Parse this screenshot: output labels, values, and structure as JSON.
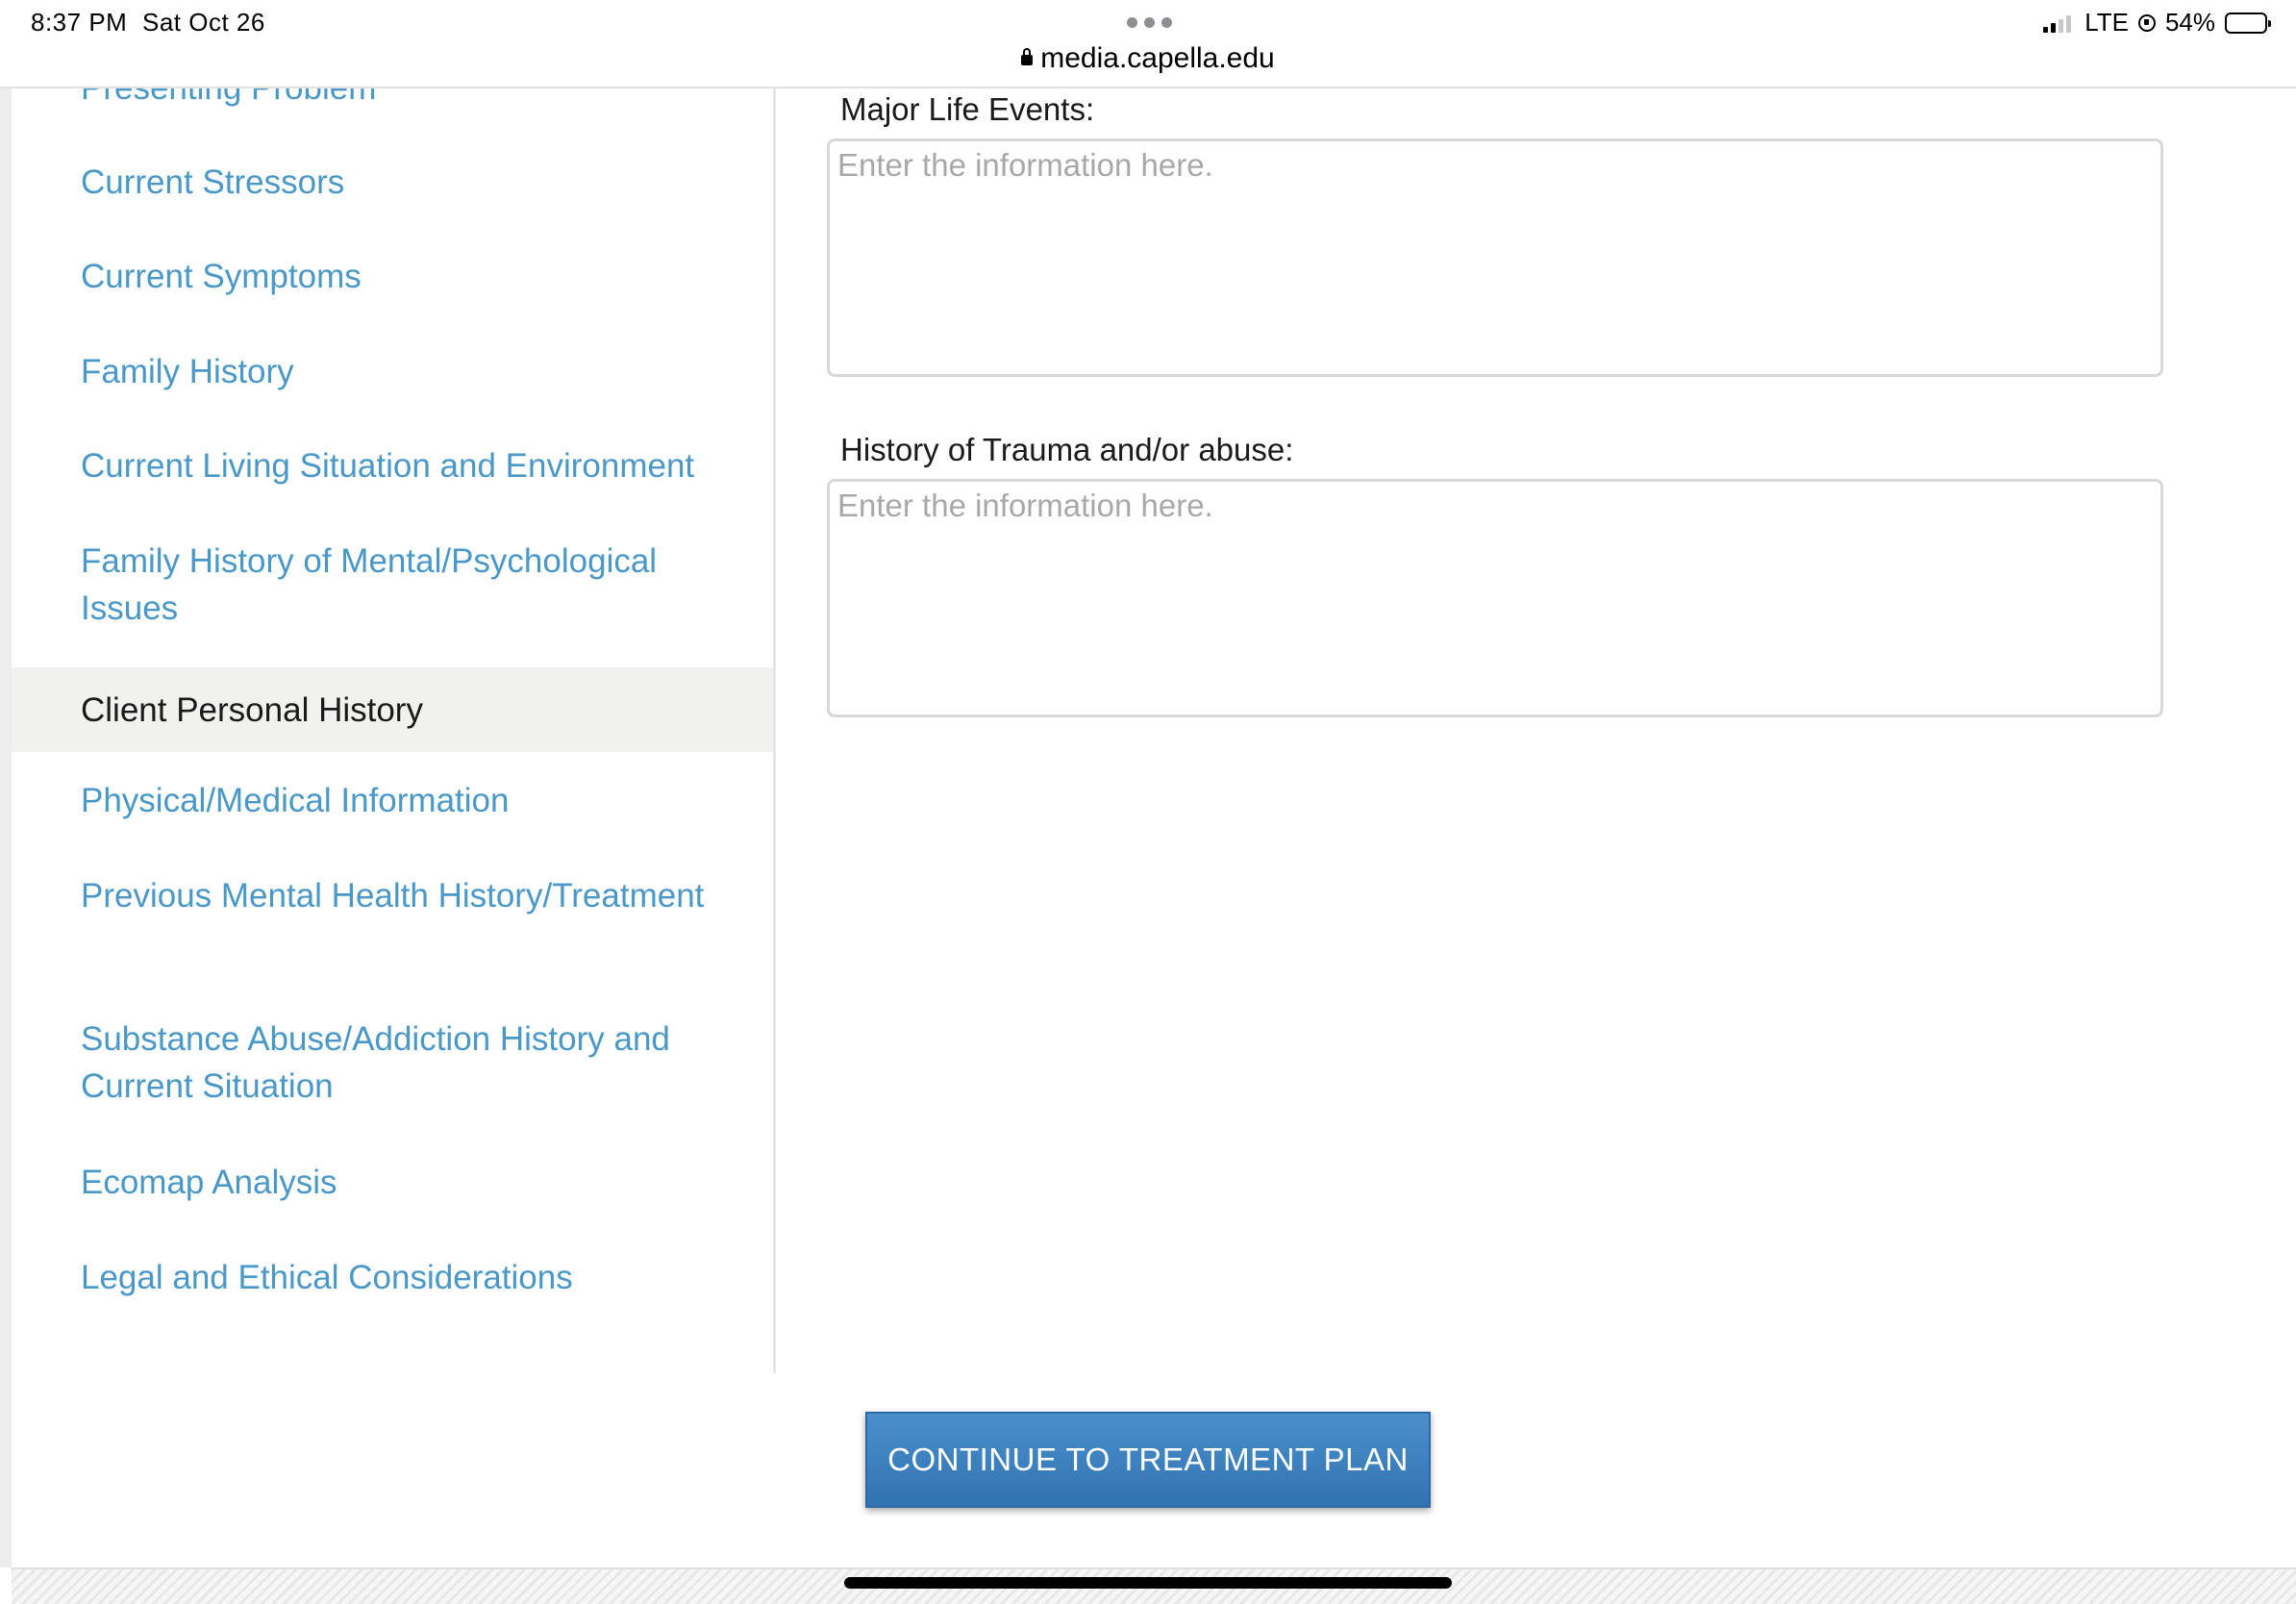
{
  "status_bar": {
    "time": "8:37 PM",
    "date": "Sat Oct 26",
    "url": "media.capella.edu",
    "network": "LTE",
    "battery_percent": "54%",
    "battery_level": 0.54,
    "signal_bars_active": 2
  },
  "sidebar": {
    "items": [
      {
        "label": "Presenting Problem",
        "active": false
      },
      {
        "label": "Current Stressors",
        "active": false
      },
      {
        "label": "Current Symptoms",
        "active": false
      },
      {
        "label": "Family History",
        "active": false
      },
      {
        "label": "Current Living Situation and Environment",
        "active": false
      },
      {
        "label": "Family History of Mental/Psychological Issues",
        "active": false
      },
      {
        "label": "Client Personal History",
        "active": true
      },
      {
        "label": "Physical/Medical Information",
        "active": false
      },
      {
        "label": "Previous Mental Health History/Treatment",
        "active": false
      },
      {
        "label": "Substance Abuse/Addiction History and Current Situation",
        "active": false
      },
      {
        "label": "Ecomap Analysis",
        "active": false
      },
      {
        "label": "Legal and Ethical Considerations",
        "active": false
      }
    ]
  },
  "form": {
    "major_life_events": {
      "label": "Major Life Events:",
      "placeholder": "Enter the information here.",
      "value": ""
    },
    "trauma_history": {
      "label": "History of Trauma and/or abuse:",
      "placeholder": "Enter the information here.",
      "value": ""
    }
  },
  "actions": {
    "continue_label": "CONTINUE TO TREATMENT PLAN"
  },
  "colors": {
    "link": "#4a98c9",
    "active_bg": "#f1f1f0",
    "button": "#3a80c0"
  }
}
